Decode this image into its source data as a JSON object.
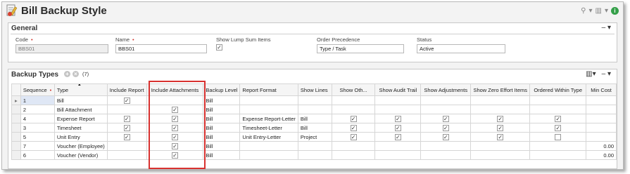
{
  "window": {
    "title": "Bill Backup Style"
  },
  "general": {
    "header": "General",
    "code": {
      "label": "Code",
      "value": "BBS01"
    },
    "name": {
      "label": "Name",
      "value": "BBS01"
    },
    "show_lump_sum": {
      "label": "Show Lump Sum Items",
      "checked": true
    },
    "order_precedence": {
      "label": "Order Precedence",
      "value": "Type / Task"
    },
    "status": {
      "label": "Status",
      "value": "Active"
    }
  },
  "backup_types": {
    "header": "Backup Types",
    "count": "(7)",
    "columns": [
      "Sequence",
      "Type",
      "Include Report",
      "Include Attachments",
      "Backup Level",
      "Report Format",
      "Show Lines",
      "Show Oth...",
      "Show Audit Trail",
      "Show Adjustments",
      "Show Zero Effort Items",
      "Ordered Within Type",
      "Min Cost"
    ],
    "rows": [
      {
        "sequence": "1",
        "type": "Bill",
        "include_report": true,
        "include_attachments": false,
        "backup_level": "Bill",
        "report_format": "",
        "show_lines": "",
        "show_oth": false,
        "show_audit": false,
        "show_adj": false,
        "show_zero": false,
        "ordered": false,
        "min_cost": ""
      },
      {
        "sequence": "2",
        "type": "Bill Attachment",
        "include_report": false,
        "include_attachments": true,
        "backup_level": "Bill",
        "report_format": "",
        "show_lines": "",
        "show_oth": false,
        "show_audit": false,
        "show_adj": false,
        "show_zero": false,
        "ordered": false,
        "min_cost": ""
      },
      {
        "sequence": "4",
        "type": "Expense Report",
        "include_report": true,
        "include_attachments": true,
        "backup_level": "Bill",
        "report_format": "Expense Report-Letter",
        "show_lines": "Bill",
        "show_oth": true,
        "show_audit": true,
        "show_adj": true,
        "show_zero": true,
        "ordered": true,
        "min_cost": ""
      },
      {
        "sequence": "3",
        "type": "Timesheet",
        "include_report": true,
        "include_attachments": true,
        "backup_level": "Bill",
        "report_format": "Timesheet-Letter",
        "show_lines": "Bill",
        "show_oth": true,
        "show_audit": true,
        "show_adj": true,
        "show_zero": true,
        "ordered": true,
        "min_cost": ""
      },
      {
        "sequence": "5",
        "type": "Unit Entry",
        "include_report": true,
        "include_attachments": true,
        "backup_level": "Bill",
        "report_format": "Unit Entry-Letter",
        "show_lines": "Project",
        "show_oth": true,
        "show_audit": true,
        "show_adj": true,
        "show_zero": true,
        "ordered": "empty",
        "min_cost": ""
      },
      {
        "sequence": "7",
        "type": "Voucher (Employee)",
        "include_report": false,
        "include_attachments": true,
        "backup_level": "Bill",
        "report_format": "",
        "show_lines": "",
        "show_oth": false,
        "show_audit": false,
        "show_adj": false,
        "show_zero": false,
        "ordered": false,
        "min_cost": "0.00"
      },
      {
        "sequence": "6",
        "type": "Voucher (Vendor)",
        "include_report": false,
        "include_attachments": true,
        "backup_level": "Bill",
        "report_format": "",
        "show_lines": "",
        "show_oth": false,
        "show_audit": false,
        "show_adj": false,
        "show_zero": false,
        "ordered": false,
        "min_cost": "0.00"
      }
    ]
  },
  "icons": {
    "check": "✓",
    "row_indicator": "▸",
    "collapse": "–",
    "dropdown": "▾",
    "sort": "▲"
  }
}
